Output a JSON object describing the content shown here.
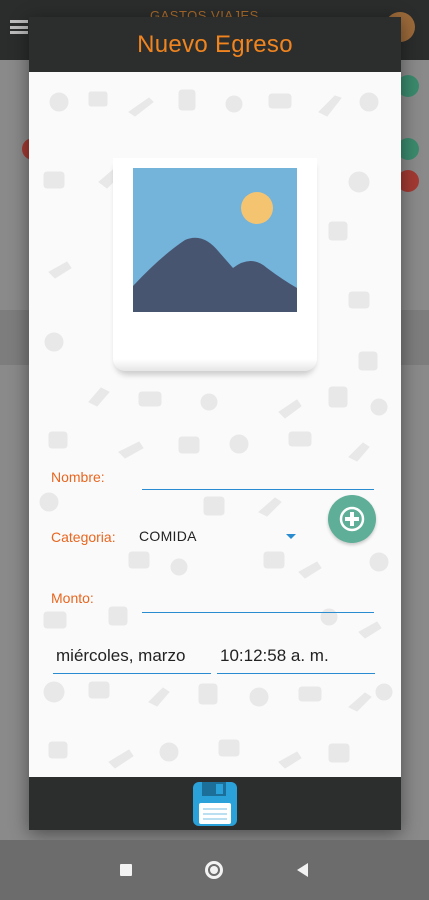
{
  "background_app": {
    "title": "GASTOS VIAJES"
  },
  "dialog": {
    "title": "Nuevo Egreso",
    "photo_icon": "image-placeholder-icon",
    "form": {
      "nombre_label": "Nombre:",
      "nombre_value": "",
      "categoria_label": "Categoria:",
      "categoria_value": "COMIDA",
      "monto_label": "Monto:",
      "monto_value": "",
      "date_value": "miércoles, marzo",
      "time_value": "10:12:58 a. m."
    },
    "add_category_icon": "plus-circle-icon",
    "save_icon": "floppy-disk-icon"
  },
  "colors": {
    "accent_orange": "#f0841f",
    "label_orange": "#e8661f",
    "underline_blue": "#2a8cd0",
    "header_dark": "#2c2e2d",
    "add_button_teal": "#5fae98",
    "save_icon_blue": "#2aa1d8"
  },
  "system_nav": {
    "recent_icon": "square-icon",
    "home_icon": "circle-home-icon",
    "back_icon": "back-triangle-icon"
  }
}
